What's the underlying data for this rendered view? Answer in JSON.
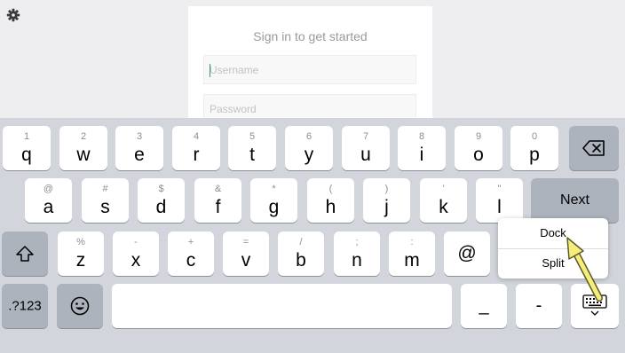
{
  "header": {
    "settings_icon": "gear-icon"
  },
  "login": {
    "title": "Sign in to get started",
    "username_placeholder": "Username",
    "password_placeholder": "Password"
  },
  "keyboard": {
    "row1": [
      {
        "sec": "1",
        "pri": "q"
      },
      {
        "sec": "2",
        "pri": "w"
      },
      {
        "sec": "3",
        "pri": "e"
      },
      {
        "sec": "4",
        "pri": "r"
      },
      {
        "sec": "5",
        "pri": "t"
      },
      {
        "sec": "6",
        "pri": "y"
      },
      {
        "sec": "7",
        "pri": "u"
      },
      {
        "sec": "8",
        "pri": "i"
      },
      {
        "sec": "9",
        "pri": "o"
      },
      {
        "sec": "0",
        "pri": "p"
      }
    ],
    "row2": [
      {
        "sec": "@",
        "pri": "a"
      },
      {
        "sec": "#",
        "pri": "s"
      },
      {
        "sec": "$",
        "pri": "d"
      },
      {
        "sec": "&",
        "pri": "f"
      },
      {
        "sec": "*",
        "pri": "g"
      },
      {
        "sec": "(",
        "pri": "h"
      },
      {
        "sec": ")",
        "pri": "j"
      },
      {
        "sec": "'",
        "pri": "k"
      },
      {
        "sec": "\"",
        "pri": "l"
      }
    ],
    "row3": [
      {
        "sec": "%",
        "pri": "z"
      },
      {
        "sec": "-",
        "pri": "x"
      },
      {
        "sec": "+",
        "pri": "c"
      },
      {
        "sec": "=",
        "pri": "v"
      },
      {
        "sec": "/",
        "pri": "b"
      },
      {
        "sec": ";",
        "pri": "n"
      },
      {
        "sec": ":",
        "pri": "m"
      },
      {
        "sec": "",
        "pri": "@"
      }
    ],
    "next_label": "Next",
    "numbers_label": ".?123",
    "underscore_label": "_",
    "dash_label": "-",
    "backspace_icon": "backspace-icon",
    "shift_icon": "shift-icon",
    "emoji_icon": "emoji-icon",
    "hide_keyboard_icon": "keyboard-hide-icon"
  },
  "popup": {
    "dock_label": "Dock",
    "split_label": "Split"
  },
  "colors": {
    "keyboard_bg": "#d2d5db",
    "key_light": "#ffffff",
    "key_dark": "#acb3bd",
    "arrow": "#f5ee7a"
  }
}
